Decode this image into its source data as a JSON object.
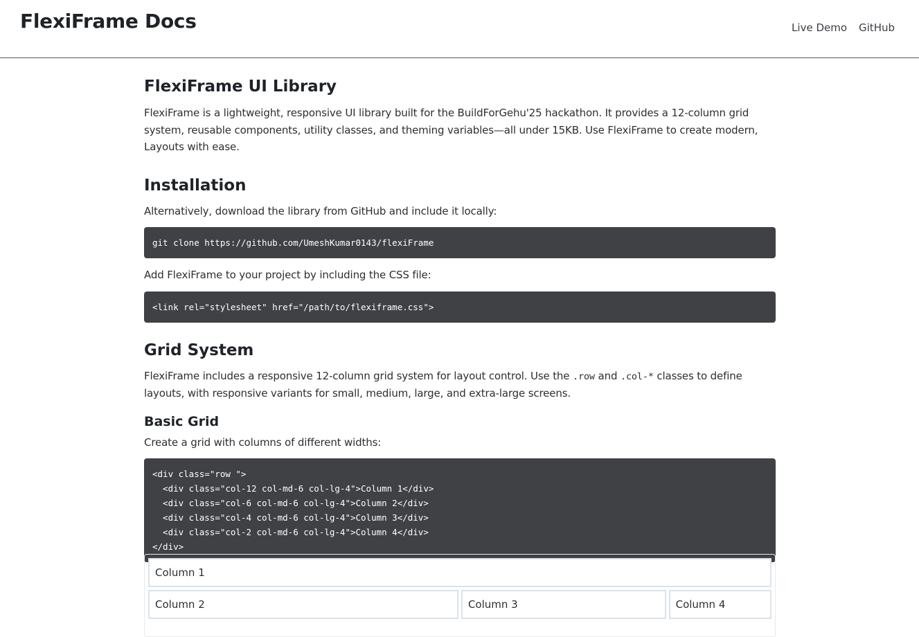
{
  "navbar": {
    "brand": "FlexiFrame Docs",
    "links": [
      "Live Demo",
      "GitHub"
    ]
  },
  "intro": {
    "title": "FlexiFrame UI Library",
    "paragraph": "FlexiFrame is a lightweight, responsive UI library built for the BuildForGehu'25 hackathon. It provides a 12-column grid system, reusable components, utility classes, and theming variables—all under 15KB. Use FlexiFrame to create modern, Layouts with ease."
  },
  "installation": {
    "title": "Installation",
    "download_text": "Alternatively, download the library from GitHub and include it locally:",
    "clone_code": "git clone https://github.com/UmeshKumar0143/flexiFrame",
    "css_text": "Add FlexiFrame to your project by including the CSS file:",
    "css_code": "<link rel=\"stylesheet\" href=\"/path/to/flexiframe.css\">"
  },
  "grid": {
    "title": "Grid System",
    "text_before_row": "FlexiFrame includes a responsive 12-column grid system for layout control. Use the ",
    "row_class": ".row",
    "text_and": " and ",
    "col_class": ".col-*",
    "text_after_col": " classes to define layouts, with responsive variants for small, medium, large, and extra-large screens.",
    "basic_title": "Basic Grid",
    "basic_text": "Create a grid with columns of different widths:",
    "basic_code": "<div class=\"row \">\n  <div class=\"col-12 col-md-6 col-lg-4\">Column 1</div>\n  <div class=\"col-6 col-md-6 col-lg-4\">Column 2</div>\n  <div class=\"col-4 col-md-6 col-lg-4\">Column 3</div>\n  <div class=\"col-2 col-md-6 col-lg-4\">Column 4</div>\n</div>",
    "demo_columns": [
      "Column 1",
      "Column 2",
      "Column 3",
      "Column 4"
    ]
  }
}
